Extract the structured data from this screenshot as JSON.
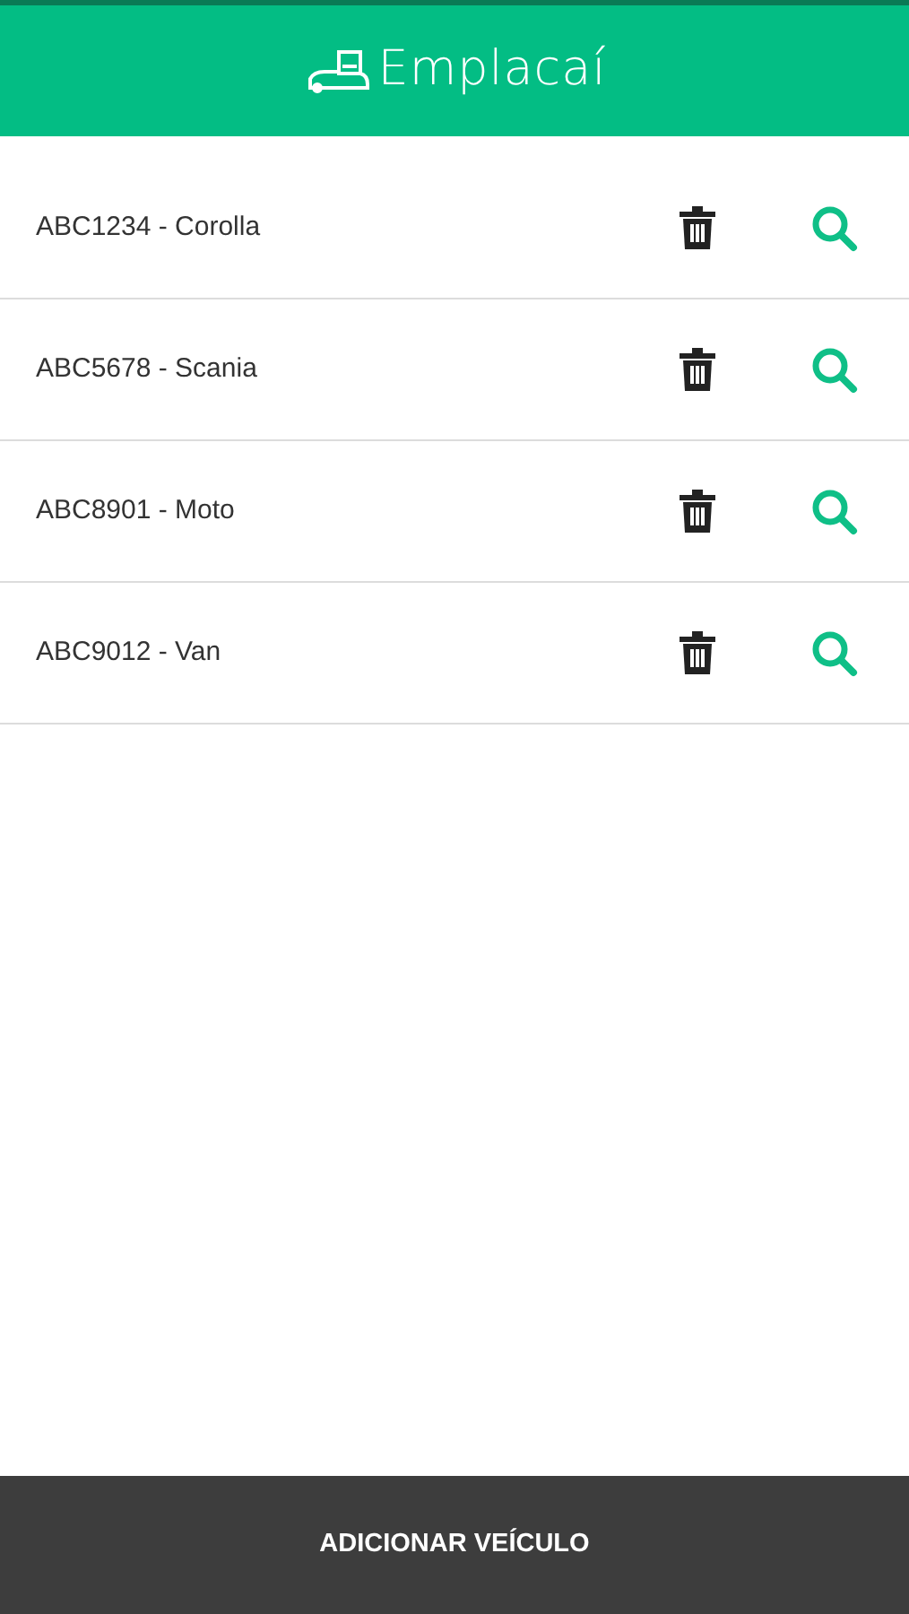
{
  "header": {
    "logo_text": "Emplacaí"
  },
  "vehicles": [
    {
      "label": "ABC1234 - Corolla"
    },
    {
      "label": "ABC5678 - Scania"
    },
    {
      "label": "ABC8901 - Moto"
    },
    {
      "label": "ABC9012 - Van"
    }
  ],
  "footer_button": {
    "label": "ADICIONAR VEÍCULO"
  }
}
